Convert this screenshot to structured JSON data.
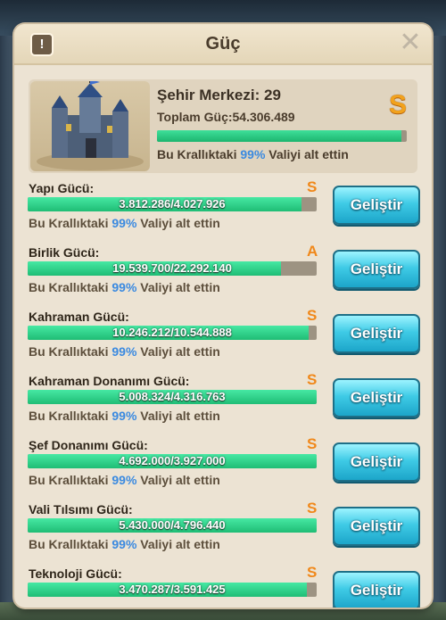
{
  "header": {
    "title": "Güç",
    "info_label": "!",
    "close_label": "✕"
  },
  "summary": {
    "city_label": "Şehir Merkezi: 29",
    "total_label": "Toplam Güç:54.306.489",
    "grade": "S",
    "progress": 0.98,
    "rank_prefix": "Bu Krallıktaki ",
    "rank_pct": "99%",
    "rank_suffix": " Valiyi alt ettin"
  },
  "rows": [
    {
      "name": "Yapı Gücü:",
      "grade": "S",
      "value": "3.812.286/4.027.926",
      "progress": 0.947,
      "rank_prefix": "Bu Krallıktaki ",
      "rank_pct": "99%",
      "rank_suffix": " Valiyi alt ettin",
      "button": "Geliştir"
    },
    {
      "name": "Birlik Gücü:",
      "grade": "A",
      "value": "19.539.700/22.292.140",
      "progress": 0.877,
      "rank_prefix": "Bu Krallıktaki ",
      "rank_pct": "99%",
      "rank_suffix": " Valiyi alt ettin",
      "button": "Geliştir"
    },
    {
      "name": "Kahraman Gücü:",
      "grade": "S",
      "value": "10.246.212/10.544.888",
      "progress": 0.972,
      "rank_prefix": "Bu Krallıktaki ",
      "rank_pct": "99%",
      "rank_suffix": " Valiyi alt ettin",
      "button": "Geliştir"
    },
    {
      "name": "Kahraman Donanımı Gücü:",
      "grade": "S",
      "value": "5.008.324/4.316.763",
      "progress": 1.0,
      "rank_prefix": "Bu Krallıktaki ",
      "rank_pct": "99%",
      "rank_suffix": " Valiyi alt ettin",
      "button": "Geliştir"
    },
    {
      "name": "Şef Donanımı Gücü:",
      "grade": "S",
      "value": "4.692.000/3.927.000",
      "progress": 1.0,
      "rank_prefix": "Bu Krallıktaki ",
      "rank_pct": "99%",
      "rank_suffix": " Valiyi alt ettin",
      "button": "Geliştir"
    },
    {
      "name": "Vali Tılsımı Gücü:",
      "grade": "S",
      "value": "5.430.000/4.796.440",
      "progress": 1.0,
      "rank_prefix": "Bu Krallıktaki ",
      "rank_pct": "99%",
      "rank_suffix": " Valiyi alt ettin",
      "button": "Geliştir"
    },
    {
      "name": "Teknoloji Gücü:",
      "grade": "S",
      "value": "3.470.287/3.591.425",
      "progress": 0.966,
      "rank_prefix": "",
      "rank_pct": "",
      "rank_suffix": "",
      "button": "Geliştir"
    }
  ],
  "colors": {
    "accent_green": "#1fbd75",
    "grade_orange": "#f0881a",
    "button_blue": "#3fcbe6",
    "pct_blue": "#3b8ae0"
  }
}
